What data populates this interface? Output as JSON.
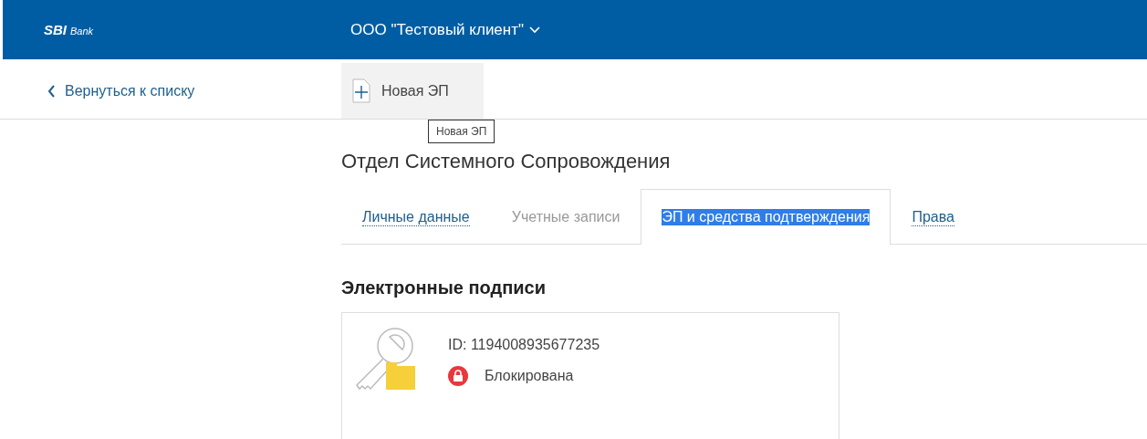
{
  "header": {
    "logo": {
      "name": "SBI",
      "suffix": "Bank"
    },
    "client": "ООО \"Тестовый клиент\""
  },
  "toolbar": {
    "back": "Вернуться к списку",
    "new_button": "Новая ЭП",
    "tooltip": "Новая ЭП"
  },
  "title": "Отдел Системного Сопровождения",
  "tabs": [
    {
      "label": "Личные данные",
      "selected": false,
      "disabled": false
    },
    {
      "label": "Учетные записи",
      "selected": false,
      "disabled": true
    },
    {
      "label": "ЭП и средства подтверждения",
      "selected": true,
      "disabled": false
    },
    {
      "label": "Права",
      "selected": false,
      "disabled": false
    }
  ],
  "section": "Электронные подписи",
  "signatures": [
    {
      "id": "ID: 1194008935677235",
      "status": "Блокирована",
      "kind": "locked"
    }
  ]
}
